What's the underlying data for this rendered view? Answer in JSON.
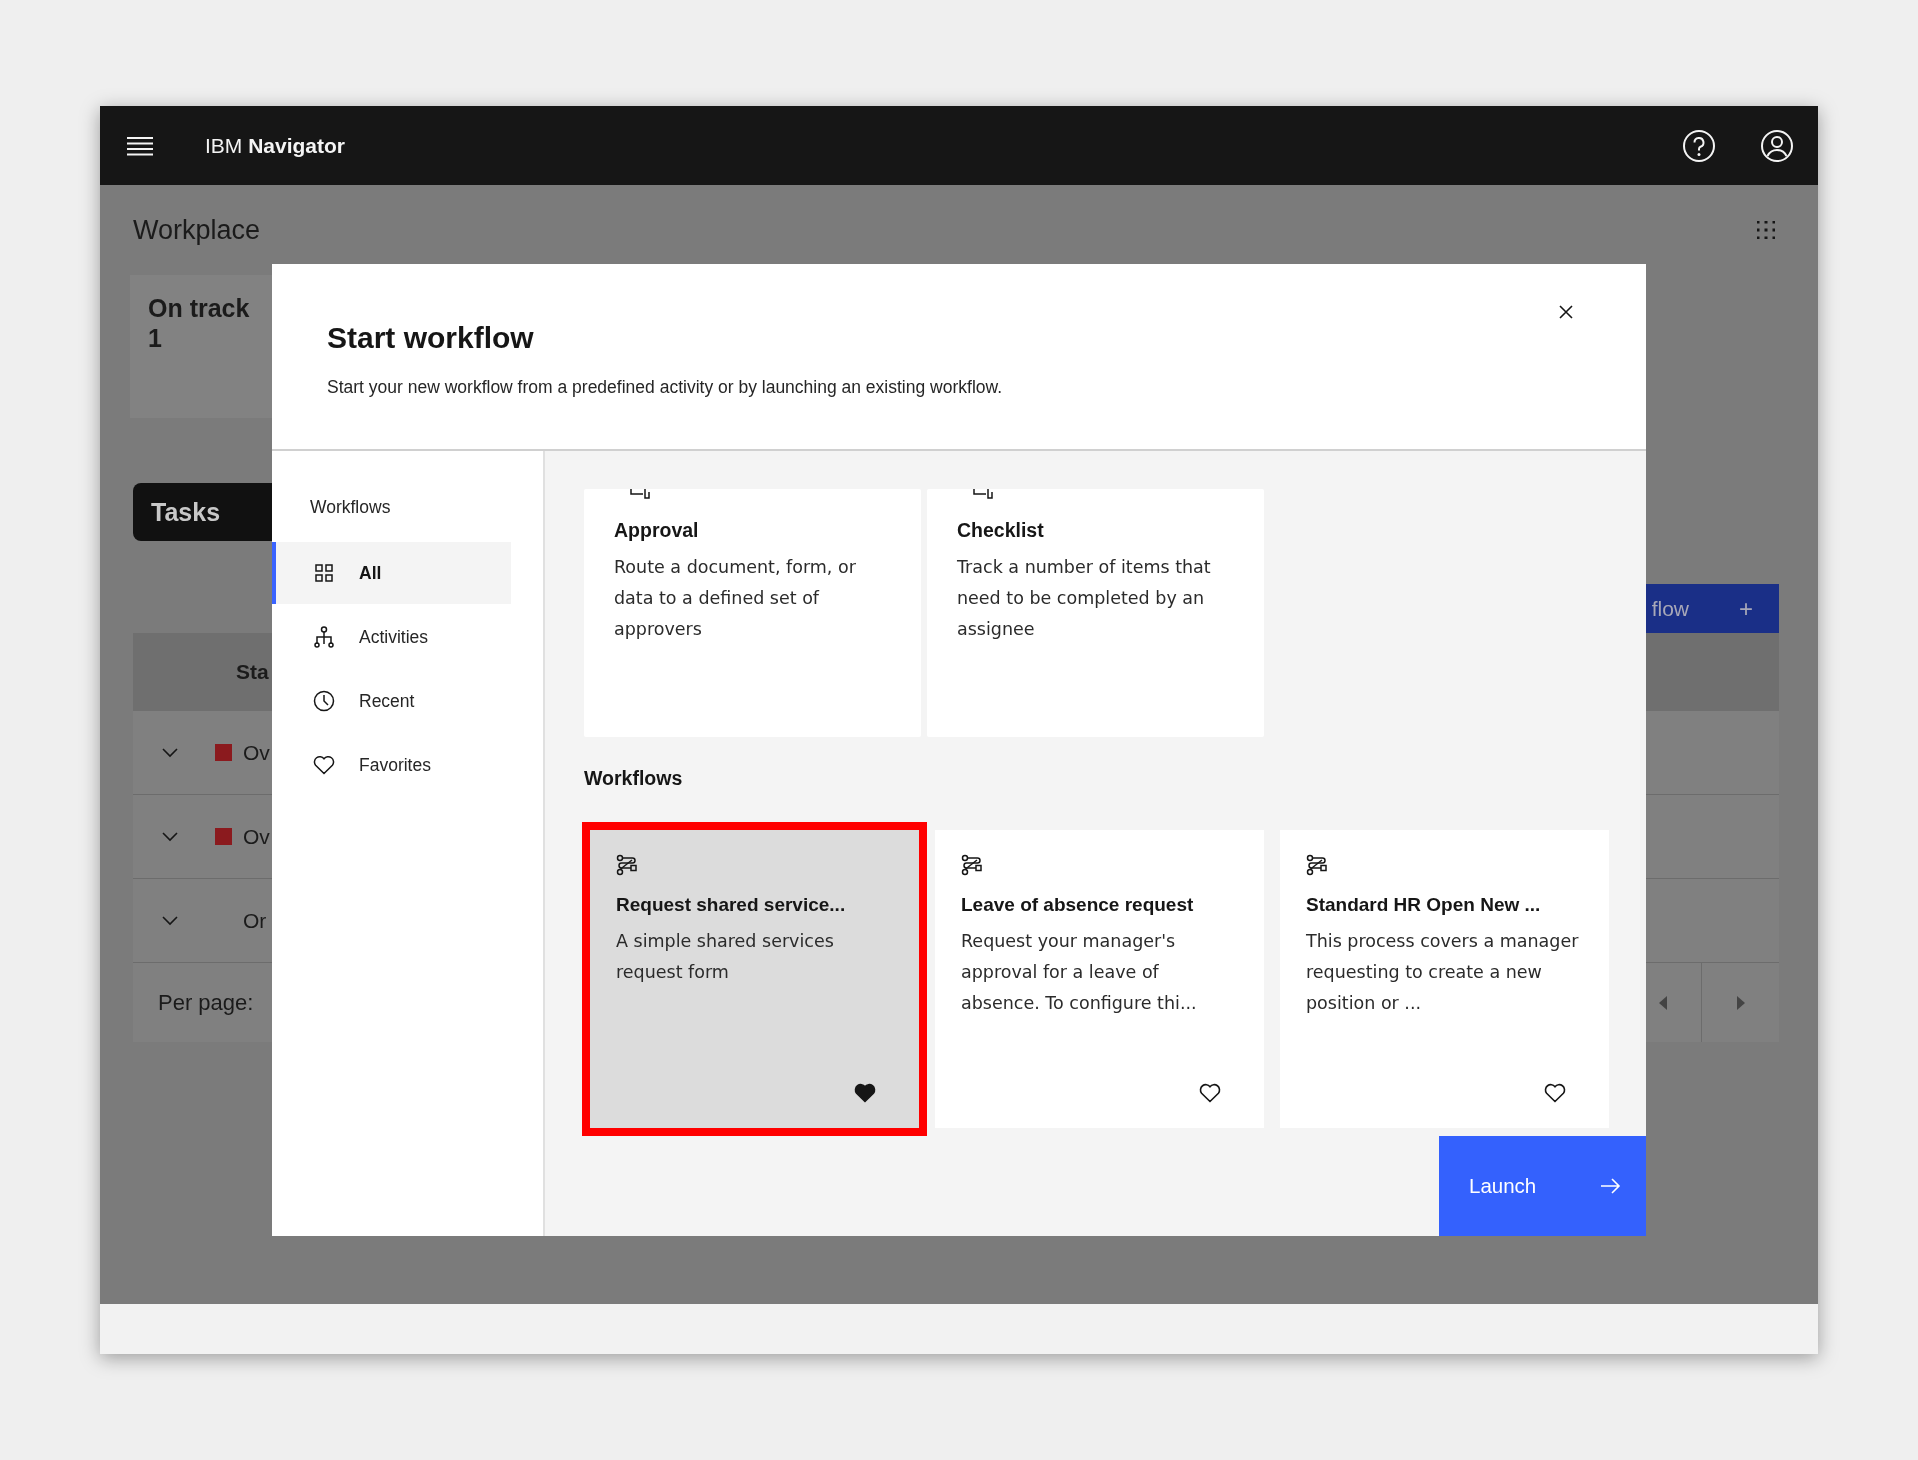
{
  "app_bar": {
    "brand_prefix": "IBM",
    "brand_name": "Navigator"
  },
  "page": {
    "title": "Workplace",
    "summary_card": {
      "label": "On track",
      "count": "1"
    },
    "tabs": [
      {
        "label": "Tasks",
        "selected": true
      }
    ],
    "new_button": {
      "label": "flow",
      "icon": "+"
    },
    "table": {
      "columns": [
        "Sta"
      ],
      "rows": [
        {
          "status": "Ov",
          "color": "#8b1a1e"
        },
        {
          "status": "Ov",
          "color": "#8b1a1e"
        },
        {
          "status": "Or"
        }
      ]
    },
    "pagination": {
      "label": "Per page:"
    }
  },
  "modal": {
    "title": "Start workflow",
    "description": "Start your new workflow from a predefined activity or by launching an existing workflow.",
    "sidebar": {
      "heading": "Workflows",
      "items": [
        {
          "label": "All",
          "selected": true
        },
        {
          "label": "Activities",
          "selected": false
        },
        {
          "label": "Recent",
          "selected": false
        },
        {
          "label": "Favorites",
          "selected": false
        }
      ]
    },
    "activities": [
      {
        "title": "Approval",
        "description": "Route a document, form, or data to a defined set of approvers"
      },
      {
        "title": "Checklist",
        "description": "Track a number of items that need to be completed by an assignee"
      }
    ],
    "workflows_heading": "Workflows",
    "workflows": [
      {
        "title": "Request shared service...",
        "description": "A simple shared services request form",
        "selected": true,
        "favorite": true
      },
      {
        "title": "Leave of absence request",
        "description": "Request your manager's approval for a leave of absence. To configure thi...",
        "selected": false,
        "favorite": false
      },
      {
        "title": "Standard HR Open New ...",
        "description": "This process covers a manager requesting to create a new position or ...",
        "selected": false,
        "favorite": false
      }
    ],
    "launch_button": "Launch"
  }
}
